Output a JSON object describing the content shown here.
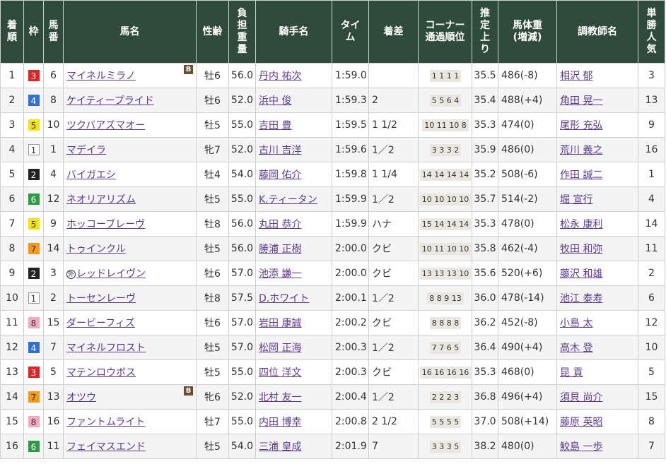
{
  "headers": {
    "rank": [
      "着",
      "順"
    ],
    "waku": "枠",
    "umaban": [
      "馬",
      "番"
    ],
    "horse": "馬名",
    "sexage": "性齢",
    "weight": [
      "負",
      "担",
      "重",
      "量"
    ],
    "jockey": "騎手名",
    "time": [
      "タイ",
      "ム"
    ],
    "margin": "着差",
    "corner": [
      "コーナー",
      "通過順位"
    ],
    "last3f": [
      "推",
      "定",
      "上",
      "り"
    ],
    "body": [
      "馬体重",
      "(増減)"
    ],
    "trainer": "調教師名",
    "pop": [
      "単",
      "勝",
      "人",
      "気"
    ]
  },
  "waku_colors": {
    "1": {
      "bg": "#ffffff",
      "fg": "#333333",
      "border": "#999999"
    },
    "2": {
      "bg": "#222222",
      "fg": "#ffffff",
      "border": "#222222"
    },
    "3": {
      "bg": "#e02424",
      "fg": "#ffffff",
      "border": "#e02424"
    },
    "4": {
      "bg": "#2f6fd6",
      "fg": "#ffffff",
      "border": "#2f6fd6"
    },
    "5": {
      "bg": "#f2e311",
      "fg": "#333333",
      "border": "#f2e311"
    },
    "6": {
      "bg": "#2e9a46",
      "fg": "#ffffff",
      "border": "#2e9a46"
    },
    "7": {
      "bg": "#f29a1a",
      "fg": "#333333",
      "border": "#f29a1a"
    },
    "8": {
      "bg": "#f4a9c0",
      "fg": "#333333",
      "border": "#f4a9c0"
    }
  },
  "rows": [
    {
      "rank": "1",
      "waku": "3",
      "num": "6",
      "name": "マイネルミラノ",
      "blink": "B",
      "prefix": "",
      "sex": "牡6",
      "kg": "56.0",
      "jockey": "丹内 祐次",
      "time": "1:59.0",
      "margin": "",
      "corner": "1 1 1 1",
      "last": "35.5",
      "body": "486",
      "diff": "(-8)",
      "trainer": "相沢 郁",
      "pop": "3"
    },
    {
      "rank": "2",
      "waku": "4",
      "num": "8",
      "name": "ケイティープライド",
      "blink": "",
      "prefix": "",
      "sex": "牡6",
      "kg": "52.0",
      "jockey": "浜中 俊",
      "time": "1:59.3",
      "margin": "2",
      "corner": "5 5 6 4",
      "last": "35.4",
      "body": "488",
      "diff": "(+4)",
      "trainer": "角田 晃一",
      "pop": "13"
    },
    {
      "rank": "3",
      "waku": "5",
      "num": "10",
      "name": "ツクバアズマオー",
      "blink": "",
      "prefix": "",
      "sex": "牡5",
      "kg": "55.0",
      "jockey": "吉田 豊",
      "time": "1:59.5",
      "margin": "1 1/2",
      "corner": "10 11 10 8",
      "last": "35.3",
      "body": "474",
      "diff": "(0)",
      "trainer": "尾形 充弘",
      "pop": "9"
    },
    {
      "rank": "4",
      "waku": "1",
      "num": "1",
      "name": "マデイラ",
      "blink": "",
      "prefix": "",
      "sex": "牝7",
      "kg": "52.0",
      "jockey": "古川 吉洋",
      "time": "1:59.6",
      "margin": "1／2",
      "corner": "3 3 3 2",
      "last": "35.9",
      "body": "486",
      "diff": "(0)",
      "trainer": "荒川 義之",
      "pop": "16"
    },
    {
      "rank": "5",
      "waku": "2",
      "num": "4",
      "name": "バイガエシ",
      "blink": "",
      "prefix": "",
      "sex": "牡4",
      "kg": "54.0",
      "jockey": "藤岡 佑介",
      "time": "1:59.8",
      "margin": "1 1/4",
      "corner": "14 14 14 14",
      "last": "35.2",
      "body": "508",
      "diff": "(-6)",
      "trainer": "作田 誠二",
      "pop": "1"
    },
    {
      "rank": "6",
      "waku": "6",
      "num": "12",
      "name": "ネオリアリズム",
      "blink": "",
      "prefix": "",
      "sex": "牡5",
      "kg": "55.0",
      "jockey": "K.ティータン",
      "time": "1:59.9",
      "margin": "1／2",
      "corner": "10 10 10 10",
      "last": "35.7",
      "body": "514",
      "diff": "(-2)",
      "trainer": "堀 宣行",
      "pop": "4"
    },
    {
      "rank": "7",
      "waku": "5",
      "num": "9",
      "name": "ホッコーブレーヴ",
      "blink": "",
      "prefix": "",
      "sex": "牡8",
      "kg": "56.0",
      "jockey": "丸田 恭介",
      "time": "1:59.9",
      "margin": "ハナ",
      "corner": "15 14 14 14",
      "last": "35.3",
      "body": "478",
      "diff": "(0)",
      "trainer": "松永 康利",
      "pop": "14"
    },
    {
      "rank": "8",
      "waku": "7",
      "num": "14",
      "name": "トゥインクル",
      "blink": "",
      "prefix": "",
      "sex": "牡5",
      "kg": "56.0",
      "jockey": "勝浦 正樹",
      "time": "2:00.0",
      "margin": "クビ",
      "corner": "10 11 10 10",
      "last": "35.8",
      "body": "462",
      "diff": "(-4)",
      "trainer": "牧田 和弥",
      "pop": "11"
    },
    {
      "rank": "9",
      "waku": "2",
      "num": "3",
      "name": "レッドレイヴン",
      "blink": "",
      "prefix": "外",
      "sex": "牡6",
      "kg": "57.0",
      "jockey": "池添 謙一",
      "time": "2:00.0",
      "margin": "クビ",
      "corner": "13 13 13 10",
      "last": "35.6",
      "body": "520",
      "diff": "(+6)",
      "trainer": "藤沢 和雄",
      "pop": "2"
    },
    {
      "rank": "10",
      "waku": "1",
      "num": "2",
      "name": "トーセンレーヴ",
      "blink": "",
      "prefix": "",
      "sex": "牡8",
      "kg": "57.5",
      "jockey": "D.ホワイト",
      "time": "2:00.1",
      "margin": "1／2",
      "corner": "8 8 9 13",
      "last": "36.0",
      "body": "478",
      "diff": "(-14)",
      "trainer": "池江 泰寿",
      "pop": "6"
    },
    {
      "rank": "11",
      "waku": "8",
      "num": "15",
      "name": "ダービーフィズ",
      "blink": "",
      "prefix": "",
      "sex": "牡6",
      "kg": "57.0",
      "jockey": "岩田 康誠",
      "time": "2:00.2",
      "margin": "クビ",
      "corner": "8 8 8 8",
      "last": "36.2",
      "body": "452",
      "diff": "(-8)",
      "trainer": "小島 太",
      "pop": "12"
    },
    {
      "rank": "12",
      "waku": "4",
      "num": "7",
      "name": "マイネルフロスト",
      "blink": "",
      "prefix": "",
      "sex": "牡5",
      "kg": "57.0",
      "jockey": "松岡 正海",
      "time": "2:00.3",
      "margin": "1／2",
      "corner": "7 7 6 5",
      "last": "36.4",
      "body": "490",
      "diff": "(+4)",
      "trainer": "高木 登",
      "pop": "10"
    },
    {
      "rank": "13",
      "waku": "3",
      "num": "5",
      "name": "マテンロウボス",
      "blink": "",
      "prefix": "",
      "sex": "牡5",
      "kg": "55.0",
      "jockey": "四位 洋文",
      "time": "2:00.3",
      "margin": "クビ",
      "corner": "16 16 16 16",
      "last": "35.3",
      "body": "468",
      "diff": "(0)",
      "trainer": "昆 貢",
      "pop": "5"
    },
    {
      "rank": "14",
      "waku": "7",
      "num": "13",
      "name": "オツウ",
      "blink": "B",
      "prefix": "",
      "sex": "牝6",
      "kg": "52.0",
      "jockey": "北村 友一",
      "time": "2:00.4",
      "margin": "1／2",
      "corner": "2 2 2 3",
      "last": "36.8",
      "body": "496",
      "diff": "(+4)",
      "trainer": "須貝 尚介",
      "pop": "15"
    },
    {
      "rank": "15",
      "waku": "8",
      "num": "16",
      "name": "ファントムライト",
      "blink": "",
      "prefix": "",
      "sex": "牡7",
      "kg": "55.0",
      "jockey": "内田 博幸",
      "time": "2:00.8",
      "margin": "2 1/2",
      "corner": "5 5 5 5",
      "last": "37.0",
      "body": "508",
      "diff": "(+14)",
      "trainer": "藤原 英昭",
      "pop": "8"
    },
    {
      "rank": "16",
      "waku": "6",
      "num": "11",
      "name": "フェイマスエンド",
      "blink": "",
      "prefix": "",
      "sex": "牡5",
      "kg": "54.0",
      "jockey": "三浦 皇成",
      "time": "2:01.9",
      "margin": "7",
      "corner": "3 3 3 5",
      "last": "38.2",
      "body": "480",
      "diff": "(0)",
      "trainer": "鮫島 一歩",
      "pop": "7"
    }
  ]
}
